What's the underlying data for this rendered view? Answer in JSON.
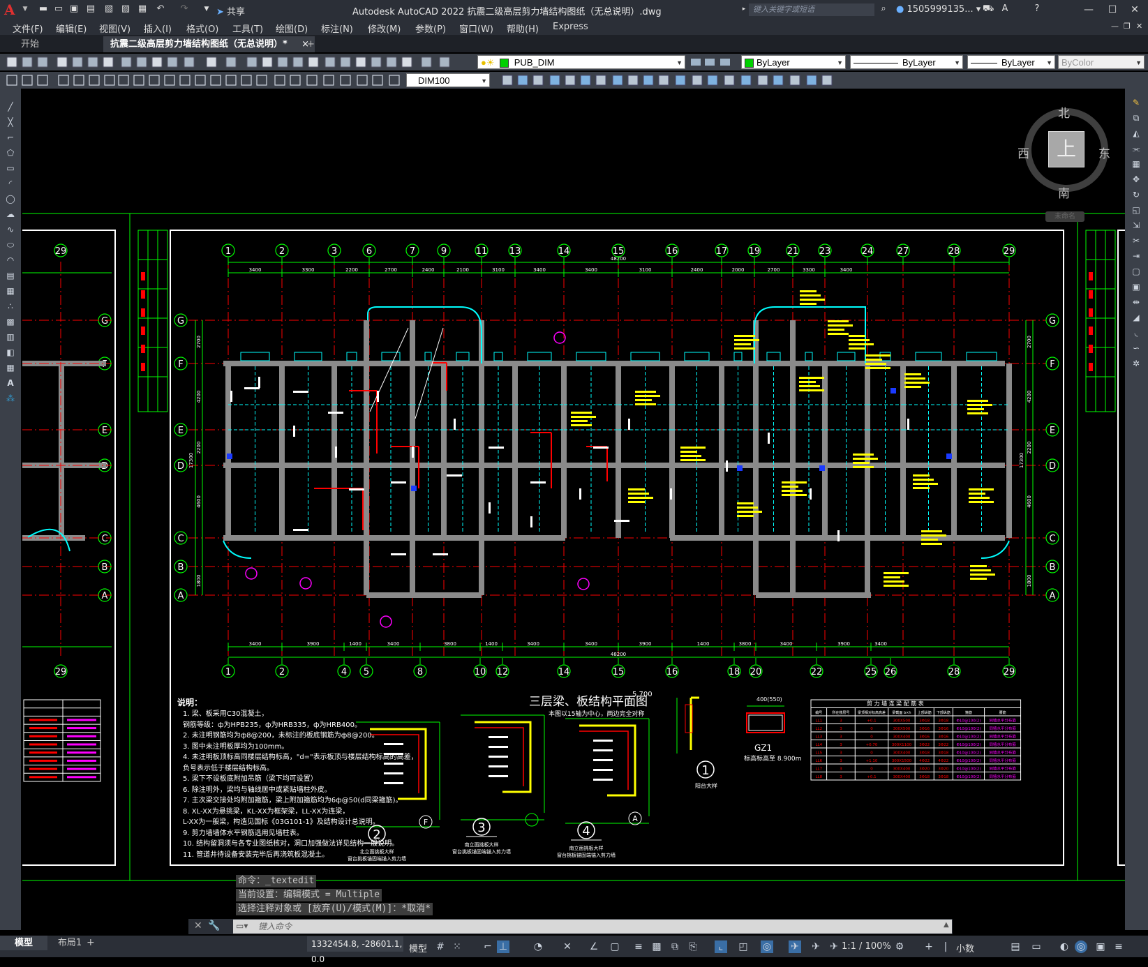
{
  "app": {
    "title": "Autodesk AutoCAD 2022    抗震二级高层剪力墙结构图纸（无总说明）.dwg",
    "share_label": "共享",
    "search_placeholder": "键入关键字或短语",
    "user": "1505999135...",
    "logo": "A"
  },
  "menu": [
    "文件(F)",
    "编辑(E)",
    "视图(V)",
    "插入(I)",
    "格式(O)",
    "工具(T)",
    "绘图(D)",
    "标注(N)",
    "修改(M)",
    "参数(P)",
    "窗口(W)",
    "帮助(H)",
    "Express"
  ],
  "tabs": {
    "start": "开始",
    "doc": "抗震二级高层剪力墙结构图纸（无总说明）*",
    "close": "×",
    "add": "+"
  },
  "toolbar": {
    "layer": "PUB_DIM",
    "color": "ByLayer",
    "linetype": "ByLayer",
    "lineweight": "ByLayer",
    "plotstyle": "ByColor",
    "dimstyle": "DIM100"
  },
  "viewcube": {
    "north": "北",
    "south": "南",
    "east": "东",
    "west": "西",
    "face": "上",
    "wcs": "未命名"
  },
  "drawing": {
    "plan_title": "三层梁、板结构平面图",
    "plan_level": "5.700",
    "plan_subtitle": "本图以15轴为中心，两边完全对称",
    "total_dim": "48200",
    "top_axes": [
      "1",
      "2",
      "3",
      "6",
      "7",
      "9",
      "11",
      "13",
      "14",
      "15",
      "16",
      "17",
      "19",
      "21",
      "23",
      "24",
      "27",
      "28",
      "29"
    ],
    "bottom_axes": [
      "1",
      "2",
      "4",
      "5",
      "8",
      "10",
      "12",
      "14",
      "15",
      "16",
      "18",
      "20",
      "22",
      "25",
      "26",
      "28",
      "29"
    ],
    "top_dims": [
      "3400",
      "3300",
      "2200",
      "2700",
      "2400",
      "2100",
      "3100",
      "3400",
      "3400",
      "3100",
      "2400",
      "2000",
      "2700",
      "3300",
      "3400"
    ],
    "bottom_dims": [
      "3400",
      "3900",
      "1400",
      "3400",
      "3800",
      "1400",
      "3400",
      "3400",
      "3900",
      "1400",
      "3800",
      "3400",
      "3900",
      "3400"
    ],
    "row_axes": [
      "G",
      "F",
      "E",
      "D",
      "C",
      "B",
      "A"
    ],
    "side_dims": [
      "2700",
      "4200",
      "2200",
      "4600",
      "1800"
    ],
    "side_total": "17300",
    "notes_title": "说明：",
    "notes": [
      "1. 梁、板采用C30混凝土，",
      "   钢筋等级：ф为HPB235，ф为HRB335，ф为HRB400。",
      "2. 未注明钢筋均为ф8@200，未标注的板底钢筋为ф8@200。",
      "3. 图中未注明板厚均为100mm。",
      "4. 未注明板顶标高同楼层结构标高，\"d=\"表示板顶与楼层结构标高的高差，",
      "   负号表示低于楼层结构标高。",
      "5. 梁下不设板底附加吊筋（梁下均可设置）",
      "6. 除注明外，梁均与轴线居中或紧贴墙柱外皮。",
      "7. 主次梁交接处均附加箍筋，梁上附加箍筋均为6ф@50(d同梁箍筋)。",
      "8. XL-XX为悬挑梁，KL-XX为框架梁，LL-XX为连梁，",
      "   L-XX为一般梁，构造见国标《03G101-1》及结构设计总说明。",
      "9. 剪力墙墙体水平钢筋选用见墙柱表。",
      "10. 结构留洞须与各专业图纸核对，洞口加强做法详见结构一般说明。",
      "11. 管道井待设备安装完毕后再浇筑板混凝土。"
    ],
    "details": [
      {
        "num": "2",
        "axis": "F",
        "caption1": "北立面挑板大样",
        "caption2": "窗台挑板锚固端锚入剪力墙"
      },
      {
        "num": "3",
        "axis": "",
        "caption1": "南立面挑板大样",
        "caption2": "窗台挑板锚固端锚入剪力墙"
      },
      {
        "num": "4",
        "axis": "A",
        "caption1": "南立面挑板大样",
        "caption2": "窗台挑板锚固端锚入剪力墙"
      }
    ],
    "detail1": {
      "num": "1",
      "caption": "阳台大样"
    },
    "gz1": {
      "label": "GZ1",
      "level": "标高标高至 8.900m",
      "size": "400(550)"
    },
    "table_title": "剪 力 墙 连 梁 配 筋 表",
    "table_headers": [
      "编号",
      "所在楼层号",
      "梁顶相对标高高差",
      "梁截面 b×h",
      "上部纵筋",
      "下部纵筋",
      "箍筋",
      "腰筋"
    ],
    "table_rows": [
      [
        "LL1",
        "3",
        "+0.1",
        "300X500",
        "3Φ18",
        "3Φ18",
        "Φ10@100(2)",
        "同墙水平分布筋"
      ],
      [
        "LL2",
        "3",
        "0",
        "300X500",
        "3Φ16",
        "3Φ16",
        "Φ10@100(2)",
        "同墙水平分布筋"
      ],
      [
        "LL3",
        "3",
        "0",
        "300X400",
        "3Φ16",
        "3Φ16",
        "Φ10@100(2)",
        "同墙水平分布筋"
      ],
      [
        "LL4",
        "3",
        "+0.70",
        "300X1100",
        "3Φ22",
        "3Φ22",
        "Φ10@100(2)",
        "同墙水平分布筋"
      ],
      [
        "LL5",
        "3",
        "0",
        "300X400",
        "3Φ18",
        "3Φ18",
        "Φ10@100(2)",
        "同墙水平分布筋"
      ],
      [
        "LL6",
        "3",
        "+1.10",
        "300X1500",
        "4Φ22",
        "4Φ22",
        "Φ10@100(2)",
        "同墙水平分布筋"
      ],
      [
        "LL7",
        "3",
        "0",
        "300X400",
        "3Φ20",
        "3Φ20",
        "Φ10@100(2)",
        "同墙水平分布筋"
      ],
      [
        "LL8",
        "3",
        "+0.1",
        "300X400",
        "3Φ18",
        "3Φ18",
        "Φ10@100(2)",
        "同墙水平分布筋"
      ]
    ]
  },
  "command": {
    "line1": "命令：_textedit",
    "line2": "当前设置：编辑模式 = Multiple",
    "line3": "选择注释对象或 [放弃(U)/模式(M)]：*取消*",
    "placeholder": "键入命令"
  },
  "status": {
    "model_tab": "模型",
    "layout1": "布局1",
    "add": "+",
    "coords": "1332454.8, -28601.1, 0.0",
    "model": "模型",
    "scale": "1:1 / 100%",
    "units": "小数"
  },
  "colors": {
    "accent_red": "#e03030",
    "cad_green": "#00ff00",
    "cad_red": "#ff0000",
    "cad_cyan": "#00ffff",
    "cad_yellow": "#ffff00",
    "cad_magenta": "#ff00ff",
    "cad_white": "#ffffff"
  }
}
